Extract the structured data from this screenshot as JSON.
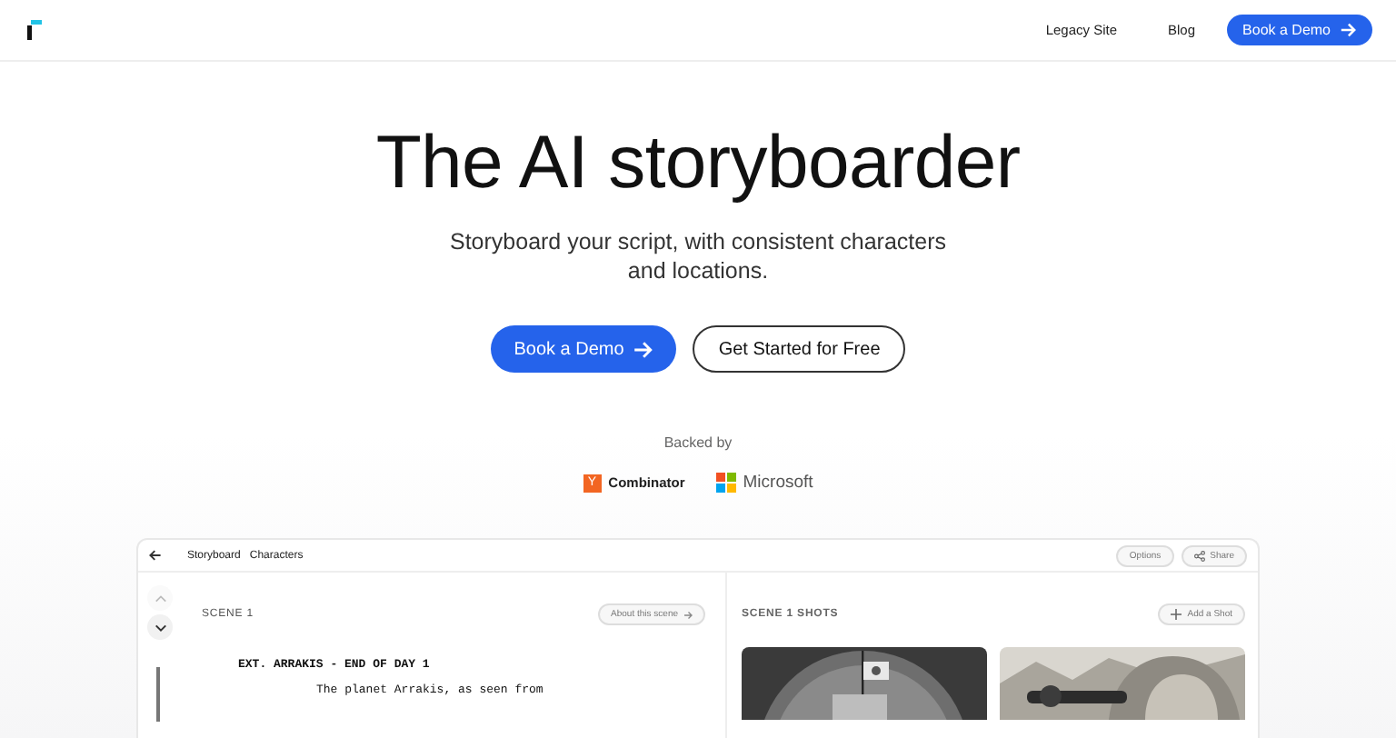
{
  "nav": {
    "links": [
      {
        "label": "Legacy Site"
      },
      {
        "label": "Blog"
      }
    ],
    "cta": "Book a Demo"
  },
  "hero": {
    "title": "The AI storyboarder",
    "subtitle": "Storyboard your script, with consistent characters and locations.",
    "primary": "Book a Demo",
    "secondary": "Get Started for Free"
  },
  "backers": {
    "label": "Backed by",
    "items": [
      {
        "kind": "yc",
        "mark": "Y",
        "name": "Combinator"
      },
      {
        "kind": "microsoft",
        "name": "Microsoft"
      }
    ]
  },
  "app": {
    "tabs": [
      {
        "label": "Storyboard"
      },
      {
        "label": "Characters"
      }
    ],
    "options": "Options",
    "share": "Share",
    "scene": {
      "heading": "SCENE 1",
      "about": "About this scene",
      "script": [
        {
          "kind": "heading",
          "text": "EXT. ARRAKIS - END OF DAY 1"
        },
        {
          "kind": "action",
          "text": "The planet Arrakis, as seen from"
        }
      ]
    },
    "shots": {
      "heading": "SCENE 1 SHOTS",
      "add": "Add a Shot"
    }
  }
}
